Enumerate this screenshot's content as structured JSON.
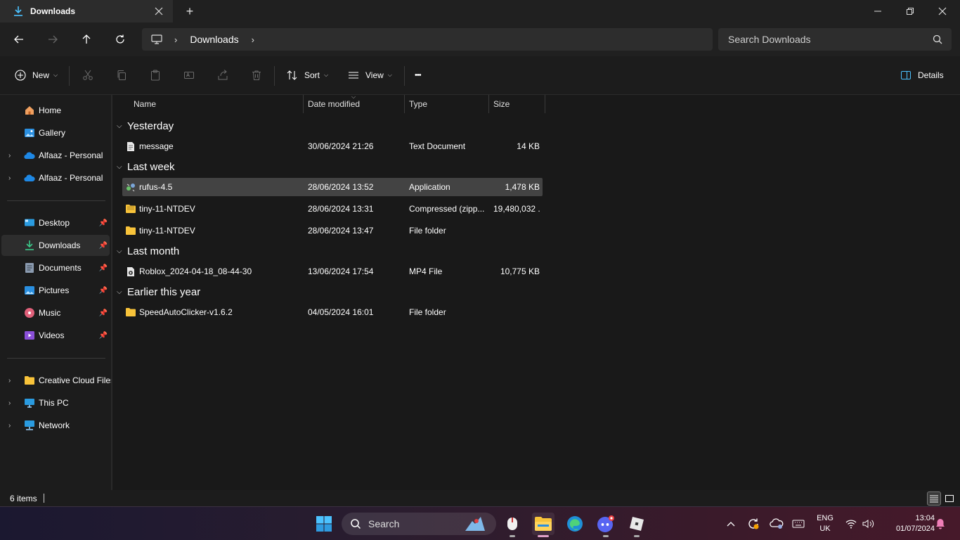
{
  "window": {
    "tab_title": "Downloads",
    "new_tab_symbol": "+"
  },
  "address": {
    "crumb": "Downloads",
    "search_placeholder": "Search Downloads"
  },
  "commands": {
    "new_label": "New",
    "sort_label": "Sort",
    "view_label": "View",
    "more_label": "•••",
    "details_label": "Details"
  },
  "sidebar": {
    "items": [
      {
        "label": "Home"
      },
      {
        "label": "Gallery"
      },
      {
        "label": "Alfaaz - Personal"
      },
      {
        "label": "Alfaaz - Personal"
      },
      {
        "label": "Desktop"
      },
      {
        "label": "Downloads"
      },
      {
        "label": "Documents"
      },
      {
        "label": "Pictures"
      },
      {
        "label": "Music"
      },
      {
        "label": "Videos"
      },
      {
        "label": "Creative Cloud Files"
      },
      {
        "label": "This PC"
      },
      {
        "label": "Network"
      }
    ]
  },
  "columns": {
    "name": "Name",
    "date": "Date modified",
    "type": "Type",
    "size": "Size"
  },
  "groups": [
    {
      "label": "Yesterday"
    },
    {
      "label": "Last week"
    },
    {
      "label": "Last month"
    },
    {
      "label": "Earlier this year"
    }
  ],
  "files": [
    {
      "name": "message",
      "date": "30/06/2024 21:26",
      "type": "Text Document",
      "size": "14 KB",
      "icon": "text-document-icon"
    },
    {
      "name": "rufus-4.5",
      "date": "28/06/2024 13:52",
      "type": "Application",
      "size": "1,478 KB",
      "icon": "rufus-app-icon"
    },
    {
      "name": "tiny-11-NTDEV",
      "date": "28/06/2024 13:31",
      "type": "Compressed (zipp...",
      "size": "19,480,032 ...",
      "icon": "zip-folder-icon"
    },
    {
      "name": "tiny-11-NTDEV",
      "date": "28/06/2024 13:47",
      "type": "File folder",
      "size": "",
      "icon": "folder-icon"
    },
    {
      "name": "Roblox_2024-04-18_08-44-30",
      "date": "13/06/2024 17:54",
      "type": "MP4 File",
      "size": "10,775 KB",
      "icon": "video-file-icon"
    },
    {
      "name": "SpeedAutoClicker-v1.6.2",
      "date": "04/05/2024 16:01",
      "type": "File folder",
      "size": "",
      "icon": "folder-icon"
    }
  ],
  "status": {
    "item_count": "6 items"
  },
  "taskbar": {
    "search_label": "Search",
    "lang_line1": "ENG",
    "lang_line2": "UK",
    "time": "13:04",
    "date": "01/07/2024"
  },
  "colors": {
    "accent": "#4cc2ff",
    "folder": "#f8c33a",
    "selection": "#434343"
  }
}
